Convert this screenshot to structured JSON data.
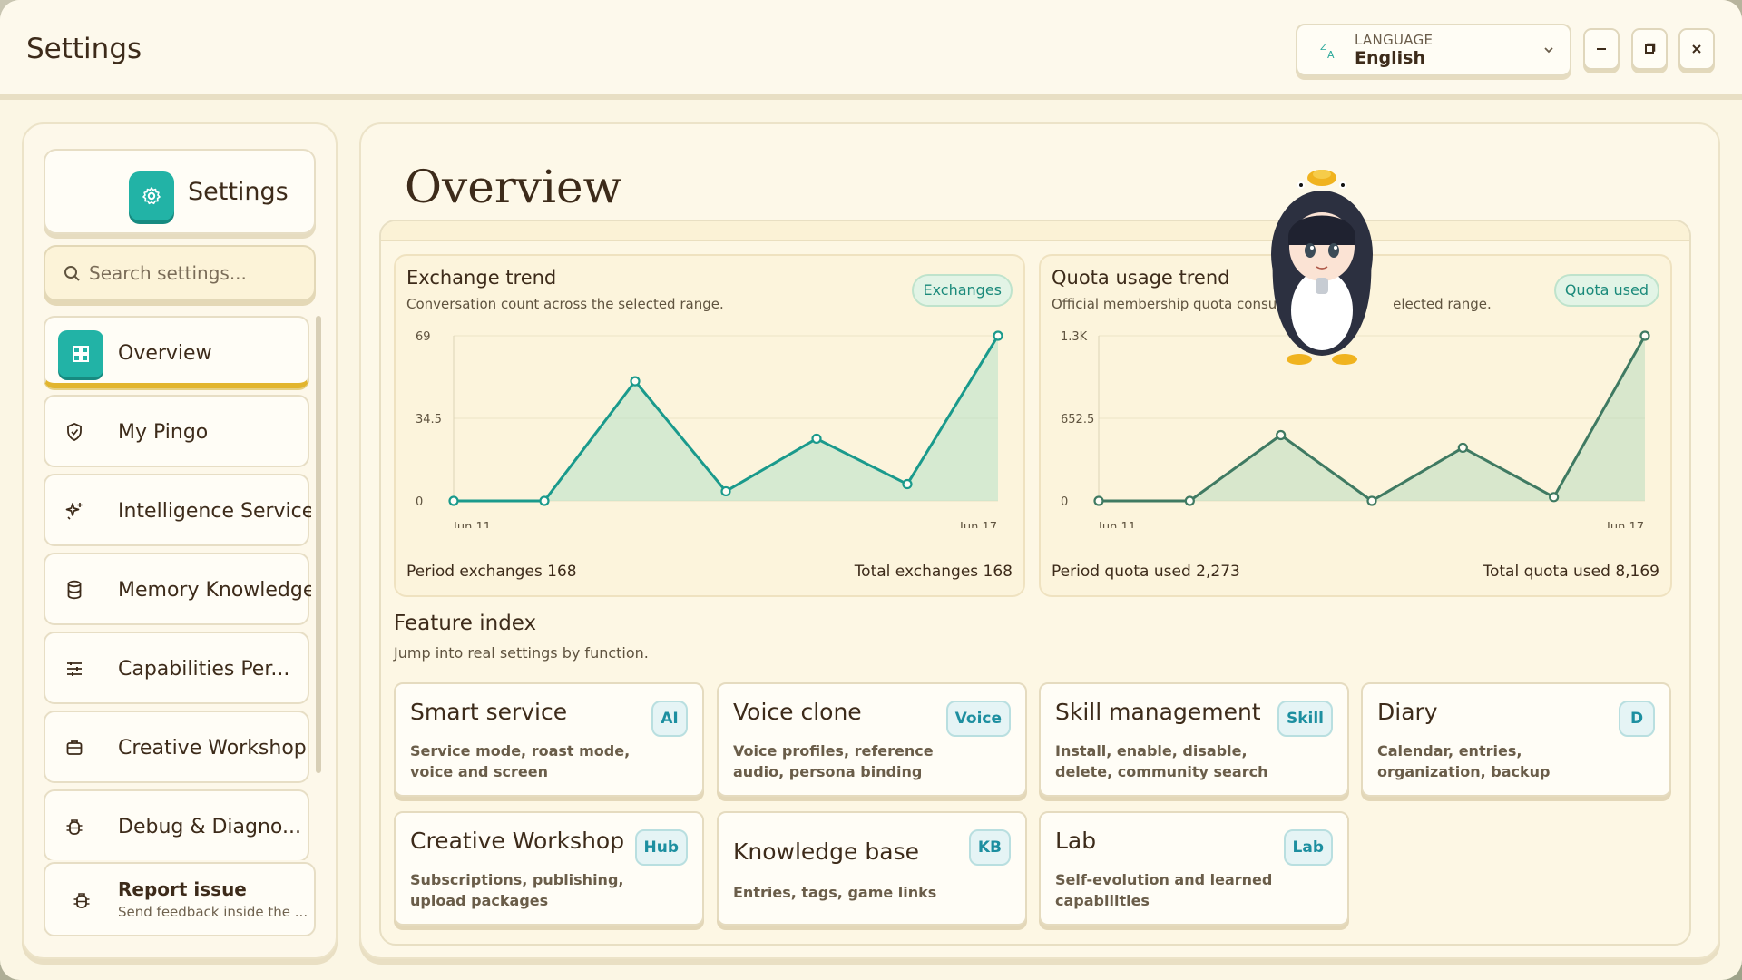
{
  "window": {
    "title": "Settings"
  },
  "language": {
    "caption": "LANGUAGE",
    "value": "English"
  },
  "sidebar": {
    "header_label": "Settings",
    "search_placeholder": "Search settings...",
    "items": [
      {
        "label": "Overview",
        "icon": "grid-icon",
        "active": true
      },
      {
        "label": "My Pingo",
        "icon": "shield-icon"
      },
      {
        "label": "Intelligence Service",
        "icon": "sparkle-icon"
      },
      {
        "label": "Memory Knowledge",
        "icon": "database-icon"
      },
      {
        "label": "Capabilities Per...",
        "icon": "sliders-icon"
      },
      {
        "label": "Creative Workshop",
        "icon": "briefcase-icon"
      },
      {
        "label": "Debug & Diagno...",
        "icon": "bug-icon"
      }
    ],
    "report": {
      "title": "Report issue",
      "subtitle": "Send feedback inside the ..."
    }
  },
  "main": {
    "title": "Overview",
    "exchange_card": {
      "title": "Exchange trend",
      "subtitle": "Conversation count across the selected range.",
      "chip": "Exchanges",
      "footer_left_label": "Period exchanges",
      "footer_left_value": "168",
      "footer_right_label": "Total exchanges",
      "footer_right_value": "168"
    },
    "quota_card": {
      "title": "Quota usage trend",
      "subtitle": "Official membership quota consume",
      "subtitle_tail": "elected range.",
      "chip": "Quota used",
      "footer_left_label": "Period quota used",
      "footer_left_value": "2,273",
      "footer_right_label": "Total quota used",
      "footer_right_value": "8,169"
    },
    "feature_index": {
      "title": "Feature index",
      "subtitle": "Jump into real settings by function.",
      "tiles": [
        {
          "title": "Smart service",
          "badge": "AI",
          "desc": "Service mode, roast mode, voice and screen"
        },
        {
          "title": "Voice clone",
          "badge": "Voice",
          "desc": "Voice profiles, reference audio, persona binding"
        },
        {
          "title": "Skill management",
          "badge": "Skill",
          "desc": "Install, enable, disable, delete, community search"
        },
        {
          "title": "Diary",
          "badge": "D",
          "desc": "Calendar, entries, organization, backup"
        },
        {
          "title": "Creative Workshop",
          "badge": "Hub",
          "desc": "Subscriptions, publishing, upload packages"
        },
        {
          "title": "Knowledge base",
          "badge": "KB",
          "desc": "Entries, tags, game links"
        },
        {
          "title": "Lab",
          "badge": "Lab",
          "desc": "Self-evolution and learned capabilities"
        }
      ]
    }
  },
  "colors": {
    "accent": "#22b3a6",
    "active_underline": "#e2b52e",
    "exchange_line": "#1a9a8c",
    "quota_line": "#3f7a62"
  },
  "chart_data": [
    {
      "type": "area",
      "title": "Exchange trend",
      "x_tick_labels": [
        "Jun 11",
        "Jun 17"
      ],
      "y_tick_labels": [
        "0",
        "34.5",
        "69"
      ],
      "ylim": [
        0,
        69
      ],
      "series": [
        {
          "values": [
            0,
            0,
            50,
            4,
            26,
            7,
            69
          ]
        }
      ]
    },
    {
      "type": "area",
      "title": "Quota usage trend",
      "x_tick_labels": [
        "Jun 11",
        "Jun 17"
      ],
      "y_tick_labels": [
        "0",
        "652.5",
        "1.3K"
      ],
      "ylim": [
        0,
        1305
      ],
      "series": [
        {
          "values": [
            0,
            0,
            520,
            0,
            420,
            30,
            1305
          ]
        }
      ]
    }
  ]
}
